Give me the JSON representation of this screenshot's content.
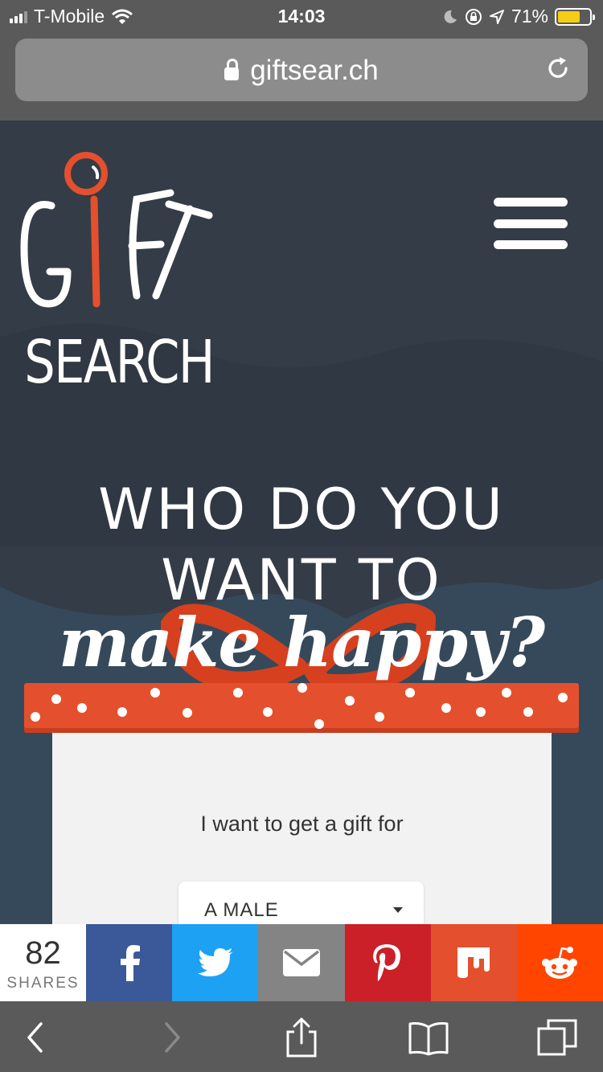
{
  "status": {
    "carrier": "T-Mobile",
    "time": "14:03",
    "battery": "71%",
    "battery_level": 0.71
  },
  "browser": {
    "domain": "giftsear.ch"
  },
  "logo": {
    "text": "GIFT SEARCH"
  },
  "hero": {
    "line1": "WHO DO YOU",
    "line2": "WANT TO",
    "script": "make happy?"
  },
  "form": {
    "prompt": "I want to get a gift for",
    "selected": "A MALE"
  },
  "share": {
    "count": "82",
    "label": "SHARES",
    "buttons": [
      {
        "name": "facebook",
        "color": "#3b5998"
      },
      {
        "name": "twitter",
        "color": "#1da1f2"
      },
      {
        "name": "email",
        "color": "#848484"
      },
      {
        "name": "pinterest",
        "color": "#cb2027"
      },
      {
        "name": "mix",
        "color": "#ff8226"
      },
      {
        "name": "reddit",
        "color": "#ff4500"
      }
    ]
  },
  "colors": {
    "accent_red": "#e4502d",
    "page_bg": "#343c47",
    "box_bg": "#f3f2f3"
  }
}
